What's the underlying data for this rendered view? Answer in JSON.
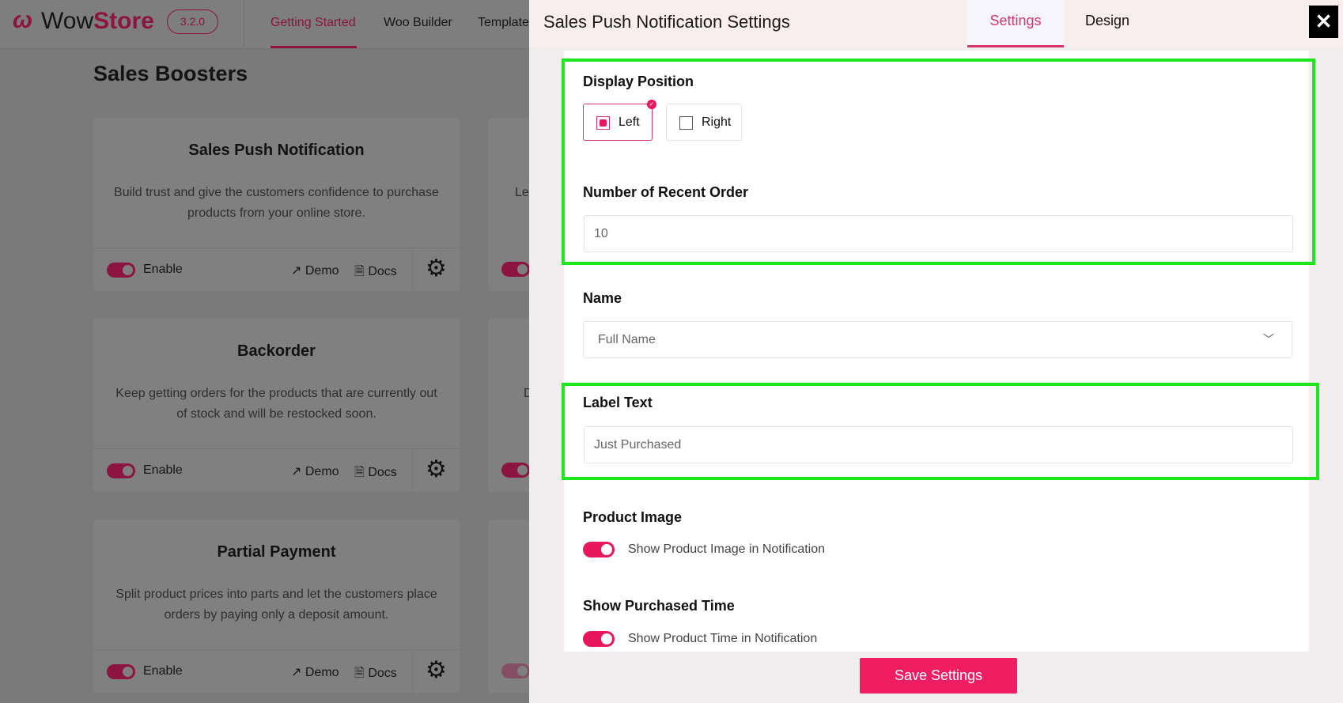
{
  "app": {
    "brand_prefix": "Wow",
    "brand_suffix": "Store",
    "version": "3.2.0"
  },
  "nav": [
    "Getting Started",
    "Woo Builder",
    "Template"
  ],
  "page_title": "Sales Boosters",
  "cards": [
    {
      "title": "Sales Push Notification",
      "desc": "Build trust and give the customers confidence to purchase products from your online store.",
      "enable": "Enable",
      "demo": "Demo",
      "docs": "Docs",
      "enabled": true
    },
    {
      "title": "Backorder",
      "desc": "Keep getting orders for the products that are currently out of stock and will be restocked soon.",
      "enable": "Enable",
      "demo": "Demo",
      "docs": "Docs",
      "enabled": true
    },
    {
      "title": "Partial Payment",
      "desc": "Split product prices into parts and let the customers place orders by paying only a deposit amount.",
      "enable": "Enable",
      "demo": "Demo",
      "docs": "Docs",
      "enabled": true
    }
  ],
  "col2_partial": [
    "Le",
    "D"
  ],
  "panel": {
    "title": "Sales Push Notification Settings",
    "tabs": [
      "Settings",
      "Design"
    ],
    "active_tab": "Settings",
    "close": "✕",
    "display_position": {
      "label": "Display Position",
      "options": [
        "Left",
        "Right"
      ],
      "selected": "Left"
    },
    "recent_order": {
      "label": "Number of Recent Order",
      "value": "10"
    },
    "name": {
      "label": "Name",
      "value": "Full Name"
    },
    "label_text": {
      "label": "Label Text",
      "value": "Just Purchased"
    },
    "product_image": {
      "label": "Product Image",
      "toggle_label": "Show Product Image in Notification",
      "on": true
    },
    "purchased_time": {
      "label": "Show Purchased Time",
      "toggle_label": "Show Product Time in Notification",
      "on": true
    },
    "save": "Save Settings"
  },
  "colors": {
    "brand": "#e8175d",
    "highlight": "#1ee51e",
    "overlay": "#7a7a7a"
  }
}
